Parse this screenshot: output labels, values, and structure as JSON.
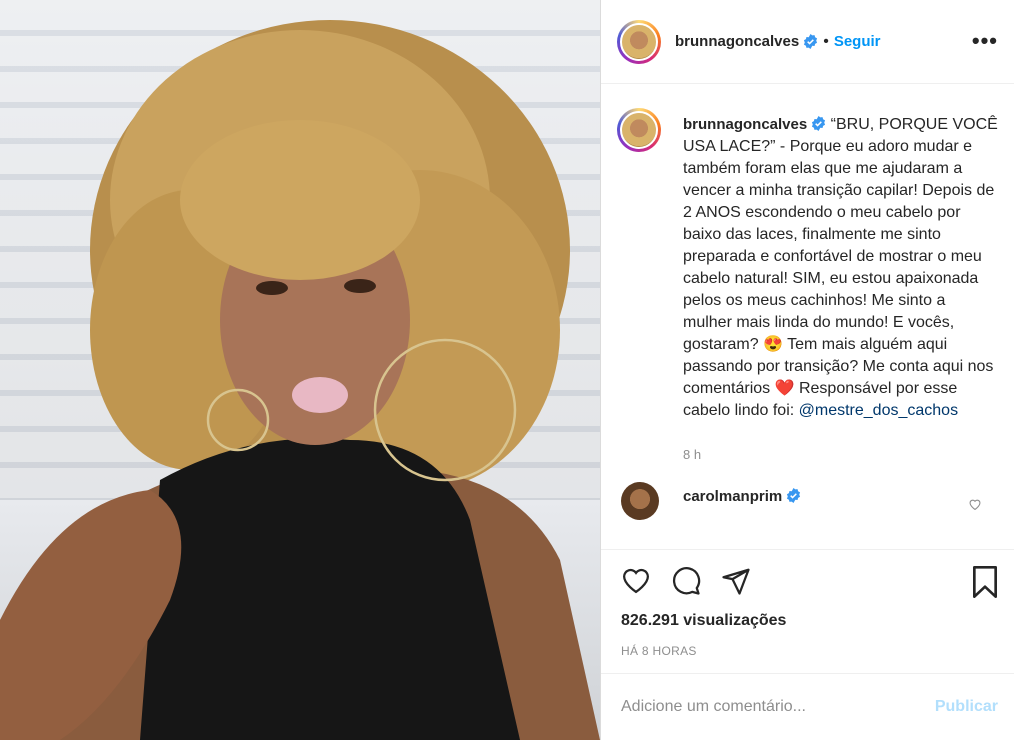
{
  "header": {
    "username": "brunnagoncalves",
    "separator": "•",
    "follow_label": "Seguir",
    "more_label": "•••"
  },
  "caption": {
    "username": "brunnagoncalves",
    "text_1": "“BRU, PORQUE VOCÊ USA LACE?” - Porque eu adoro mudar e também foram elas que me ajudaram a vencer a minha transição capilar! Depois de 2 ANOS escondendo o meu cabelo por baixo das laces, finalmente me sinto preparada e confortável de mostrar o meu cabelo natural! SIM, eu estou apaixonada pelos os meus cachinhos! Me sinto a mulher mais linda do mundo! E vocês, gostaram? ",
    "emoji_1": "😍",
    "text_2": " Tem mais alguém aqui passando por transição? Me conta aqui nos comentários ",
    "emoji_2": "❤️",
    "text_3": " Responsável por esse cabelo lindo foi: ",
    "mention": "@mestre_dos_cachos",
    "age": "8 h"
  },
  "comment": {
    "username": "carolmanprim"
  },
  "stats": {
    "views": "826.291 visualizações",
    "time": "HÁ 8 HORAS"
  },
  "add_comment": {
    "placeholder": "Adicione um comentário...",
    "publish_label": "Publicar"
  },
  "colors": {
    "link_blue": "#0095f6",
    "mention_blue": "#00376b",
    "publish_disabled": "#b2dffc"
  }
}
